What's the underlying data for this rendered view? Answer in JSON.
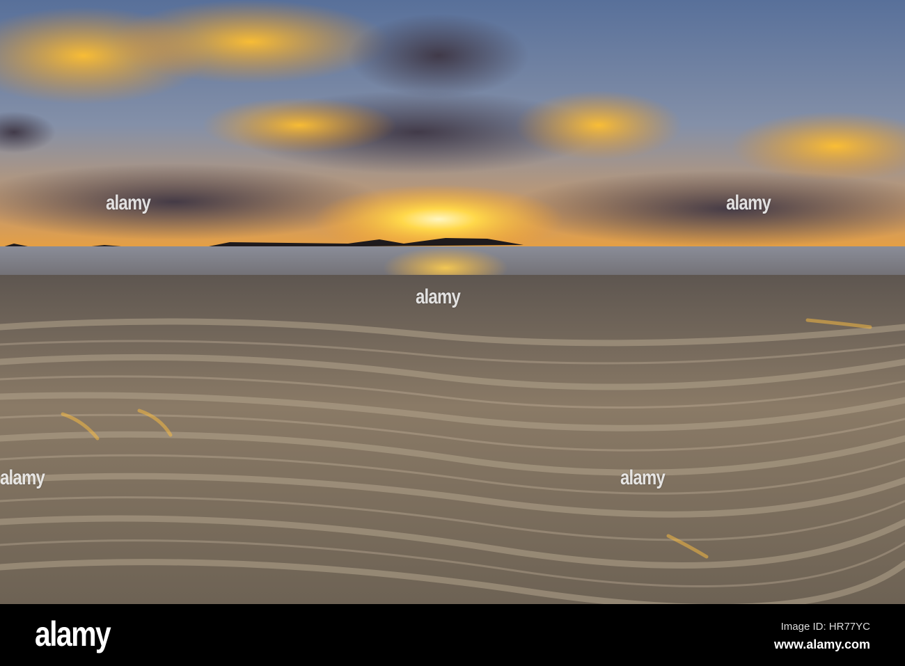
{
  "watermark": {
    "text": "alamy"
  },
  "footer": {
    "logo": "alamy",
    "image_id": "Image ID: HR77YC",
    "website": "www.alamy.com"
  },
  "colors": {
    "sun": "#ffd84a",
    "sky_top": "#5b6f96",
    "cloud_dark": "#4a4252",
    "sand": "#7a6d5e"
  }
}
